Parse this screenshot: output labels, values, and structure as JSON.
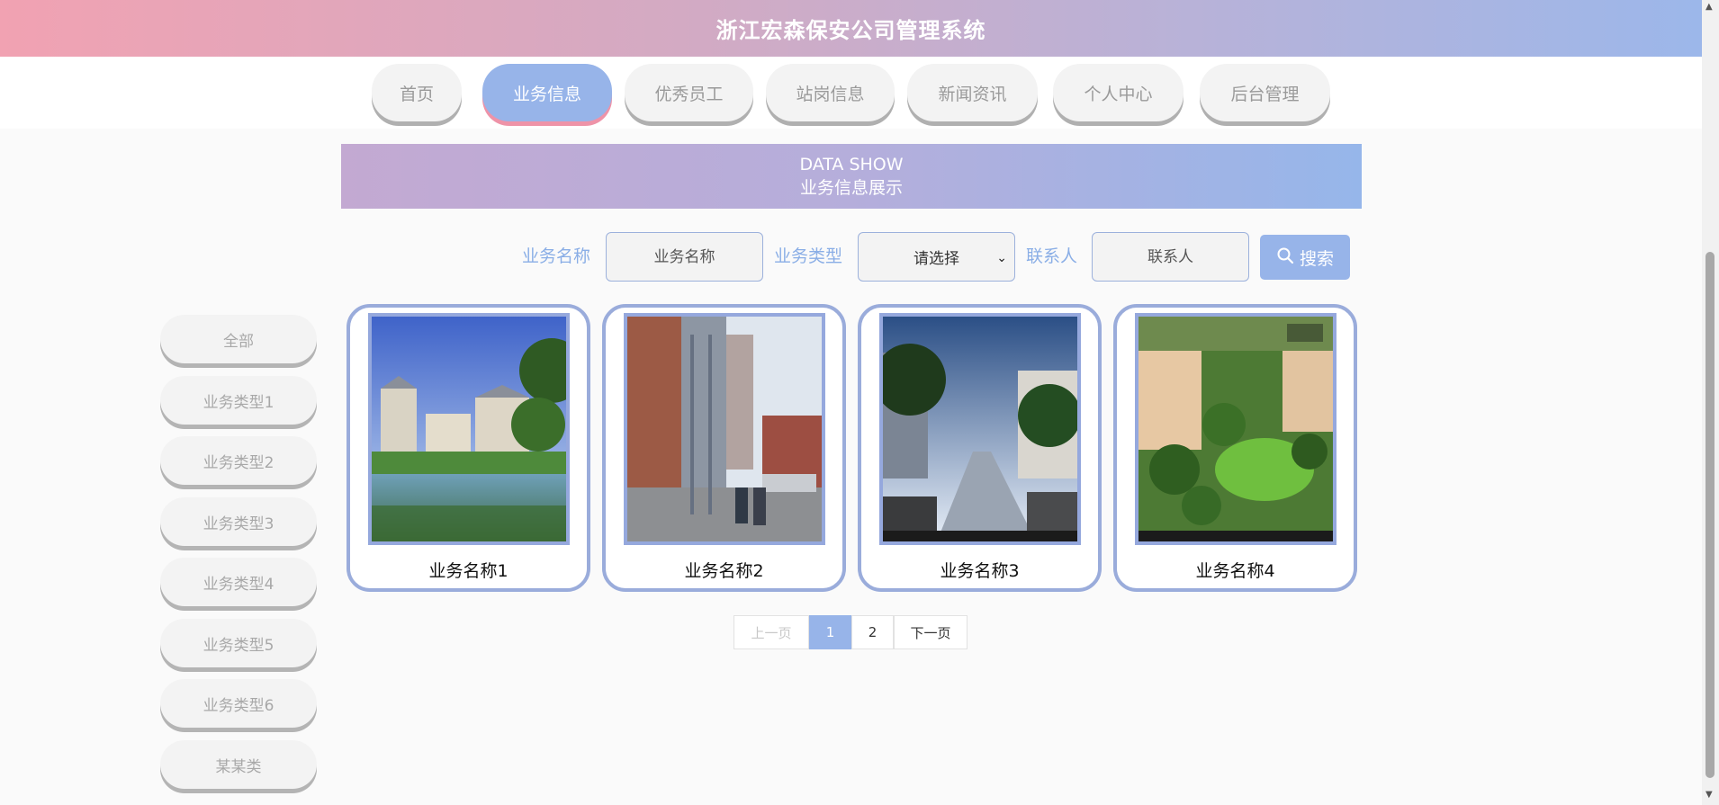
{
  "header": {
    "title": "浙江宏森保安公司管理系统"
  },
  "nav": {
    "items": [
      {
        "label": "首页"
      },
      {
        "label": "业务信息"
      },
      {
        "label": "优秀员工"
      },
      {
        "label": "站岗信息"
      },
      {
        "label": "新闻资讯"
      },
      {
        "label": "个人中心"
      },
      {
        "label": "后台管理"
      }
    ],
    "active": "业务信息"
  },
  "banner": {
    "en": "DATA SHOW",
    "cn": "业务信息展示"
  },
  "search": {
    "name_label": "业务名称",
    "name_placeholder": "业务名称",
    "type_label": "业务类型",
    "type_selected": "请选择",
    "contact_label": "联系人",
    "contact_placeholder": "联系人",
    "button_label": "搜索",
    "button_icon": "search-icon"
  },
  "sidebar": {
    "items": [
      {
        "label": "全部"
      },
      {
        "label": "业务类型1"
      },
      {
        "label": "业务类型2"
      },
      {
        "label": "业务类型3"
      },
      {
        "label": "业务类型4"
      },
      {
        "label": "业务类型5"
      },
      {
        "label": "业务类型6"
      },
      {
        "label": "某某类"
      }
    ]
  },
  "cards": [
    {
      "title": "业务名称1"
    },
    {
      "title": "业务名称2"
    },
    {
      "title": "业务名称3"
    },
    {
      "title": "业务名称4"
    }
  ],
  "pagination": {
    "prev": "上一页",
    "pages": [
      "1",
      "2"
    ],
    "current": "1",
    "next": "下一页"
  },
  "colors": {
    "accent": "#97b4e9",
    "pink": "#f1a2b2",
    "border": "#9aacdb"
  }
}
